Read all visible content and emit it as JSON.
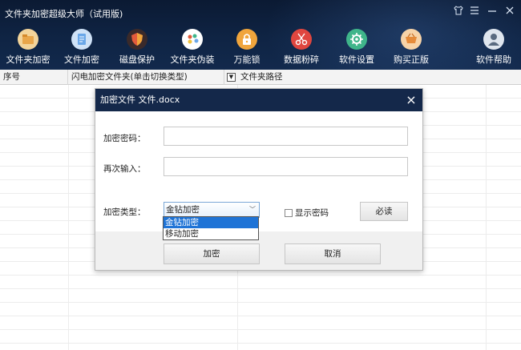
{
  "app": {
    "title": "文件夹加密超级大师（试用版)",
    "window_controls": [
      "shirt-icon",
      "menu-icon",
      "minimize-icon",
      "close-icon"
    ]
  },
  "toolbar": [
    {
      "label": "文件夹加密",
      "icon": "folder-icon",
      "color": "#e9a64a"
    },
    {
      "label": "文件加密",
      "icon": "document-icon",
      "color": "#6aa7e8"
    },
    {
      "label": "磁盘保护",
      "icon": "shield-icon",
      "color": "#e25b3c"
    },
    {
      "label": "文件夹伪装",
      "icon": "palette-icon",
      "color": "#ffffff"
    },
    {
      "label": "万能锁",
      "icon": "lock-icon",
      "color": "#f0a53c"
    },
    {
      "label": "数据粉碎",
      "icon": "scissors-icon",
      "color": "#e0463f"
    },
    {
      "label": "软件设置",
      "icon": "gear-icon",
      "color": "#3fb58a"
    },
    {
      "label": "购买正版",
      "icon": "cart-icon",
      "color": "#e58b3b"
    },
    {
      "label": "软件帮助",
      "icon": "user-icon",
      "color": "#dfe6ee"
    }
  ],
  "table": {
    "columns": [
      "序号",
      "闪电加密文件夹(单击切换类型)",
      "文件夹路径"
    ]
  },
  "dialog": {
    "title": "加密文件 文件.docx",
    "password_label": "加密密码：",
    "password_value": "",
    "confirm_label": "再次输入：",
    "confirm_value": "",
    "type_label": "加密类型：",
    "type_selected": "金钻加密",
    "type_options": [
      "金钻加密",
      "移动加密"
    ],
    "show_password_label": "显示密码",
    "must_read_label": "必读",
    "encrypt_label": "加密",
    "cancel_label": "取消"
  }
}
